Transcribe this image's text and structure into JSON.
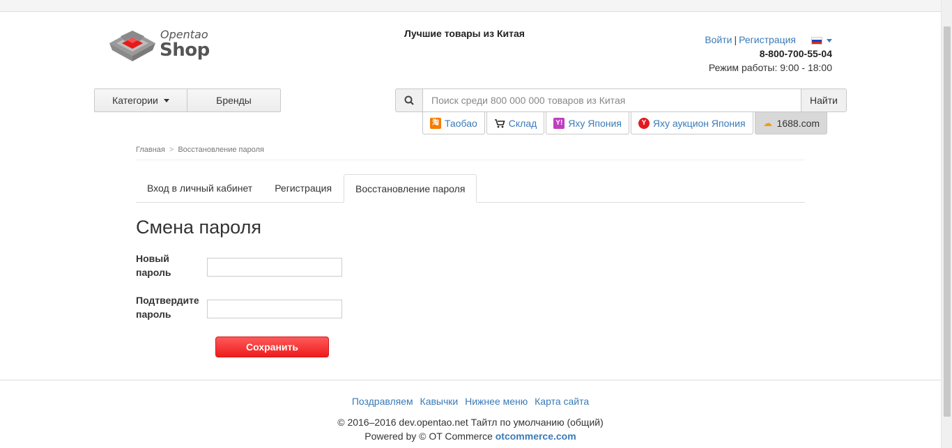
{
  "header": {
    "slogan": "Лучшие товары из Китая",
    "login": "Войти",
    "separator": "|",
    "register": "Регистрация",
    "phone": "8-800-700-55-04",
    "hours": "Режим работы: 9:00 - 18:00",
    "logo": {
      "line1": "Opentao",
      "line2": "Shop"
    }
  },
  "catbar": {
    "categories": "Категории",
    "brands": "Бренды"
  },
  "search": {
    "placeholder": "Поиск среди 800 000 000 товаров из Китая",
    "button": "Найти"
  },
  "providers": [
    {
      "label": "Таобао",
      "icon": "taobao-icon",
      "color": "#f57c00"
    },
    {
      "label": "Склад",
      "icon": "cart-icon",
      "color": "#222222"
    },
    {
      "label": "Яху Япония",
      "icon": "yahoo-icon",
      "color": "#c03fbf"
    },
    {
      "label": "Яху аукцион Япония",
      "icon": "yahoo-auction-icon",
      "color": "#e21b22"
    },
    {
      "label": "1688.com",
      "icon": "1688-icon",
      "color": "#f39c12"
    }
  ],
  "breadcrumb": {
    "home": "Главная",
    "sep": ">",
    "current": "Восстановление пароля"
  },
  "tabs": [
    {
      "label": "Вход в личный кабинет"
    },
    {
      "label": "Регистрация"
    },
    {
      "label": "Восстановление пароля"
    }
  ],
  "form": {
    "title": "Смена пароля",
    "new_password_label": "Новый пароль",
    "confirm_label": "Подтвердите пароль",
    "save": "Сохранить"
  },
  "footer": {
    "links": [
      "Поздравляем",
      "Кавычки",
      "Нижнее меню",
      "Карта сайта"
    ],
    "copyright": "© 2016–2016 dev.opentao.net Тайтл по умолчанию (общий)",
    "powered_prefix": "Powered by © OT Commerce",
    "powered_link": "otcommerce.com"
  },
  "colors": {
    "accent": "#3a7ab8",
    "save_button": "#ee1c1c"
  }
}
